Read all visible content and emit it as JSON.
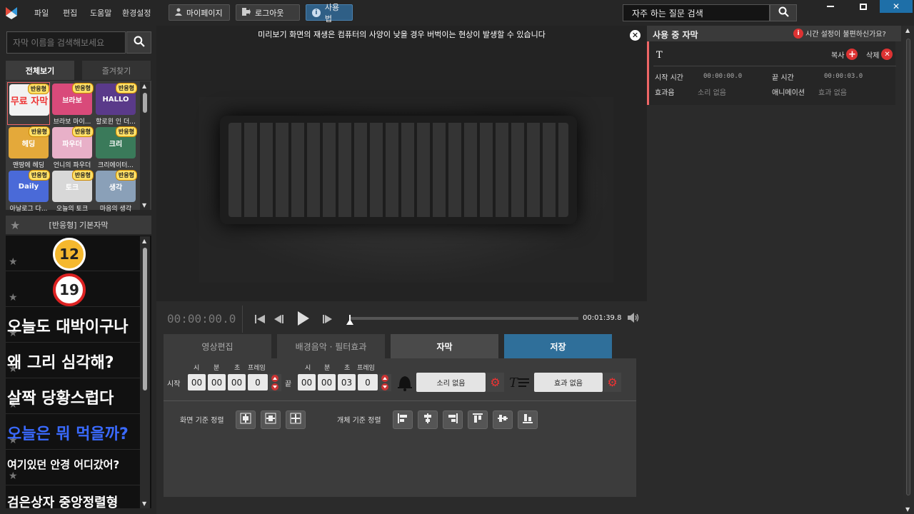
{
  "menu": [
    "파일",
    "편집",
    "도움말",
    "환경설정"
  ],
  "toolbar": {
    "mypage": "마이페이지",
    "logout": "로그아웃",
    "usage": "사용법"
  },
  "faq_search": {
    "text": "자주 하는 질문 검색"
  },
  "left": {
    "search_placeholder": "자막 이름을 검색해보세요",
    "tab_all": "전체보기",
    "tab_fav": "즐겨찾기",
    "badge": "반응형",
    "thumbs": [
      {
        "label": "",
        "art": "무료 자막",
        "color": "#f2f2f2"
      },
      {
        "label": "브라보 마이...",
        "art": "브라보",
        "color": "#d94a7a"
      },
      {
        "label": "할로윈 인 더...",
        "art": "HALLO",
        "color": "#5a3a8a"
      },
      {
        "label": "맨땅에 헤딩",
        "art": "헤딩",
        "color": "#e4a93a"
      },
      {
        "label": "언니의 파우더",
        "art": "파우더",
        "color": "#e8b0c8"
      },
      {
        "label": "크리에이터...",
        "art": "크리",
        "color": "#3a7a5a"
      },
      {
        "label": "아날로그 다...",
        "art": "Daily",
        "color": "#4a6ad8"
      },
      {
        "label": "오늘의 토크",
        "art": "토크",
        "color": "#d8d8d8"
      },
      {
        "label": "마음의 생각",
        "art": "생각",
        "color": "#8aa0b8"
      }
    ],
    "list_header": "[반응형] 기본자막",
    "list": [
      {
        "text": "12",
        "kind": "age12"
      },
      {
        "text": "19",
        "kind": "age19"
      },
      {
        "text": "오늘도 대박이구나",
        "kind": "text"
      },
      {
        "text": "왜 그리 심각해?",
        "kind": "text"
      },
      {
        "text": "살짝 당황스럽다",
        "kind": "text"
      },
      {
        "text": "오늘은 뭐 먹을까?",
        "kind": "text"
      },
      {
        "text": "여기있던 안경 어디갔어?",
        "kind": "text"
      },
      {
        "text": "검은상자 중앙정렬형",
        "kind": "text"
      }
    ]
  },
  "preview": {
    "notice": "미리보기 화면의 재생은 컴퓨터의 사양이 낮을 경우 버벅이는 현상이 발생할 수 있습니다"
  },
  "player": {
    "timecode": "00:00:00.0",
    "end_time": "00:01:39.8",
    "progress": 0
  },
  "edit_tabs": [
    "영상편집",
    "배경음악 · 필터효과",
    "자막",
    "저장"
  ],
  "timing": {
    "start_label": "시작",
    "end_label": "끝",
    "units": [
      "시",
      "분",
      "초",
      "프레임"
    ],
    "start": [
      "00",
      "00",
      "00",
      "0"
    ],
    "end": [
      "00",
      "00",
      "03",
      "0"
    ],
    "sound": "소리 없음",
    "effect": "효과 없음"
  },
  "align": {
    "screen_label": "화면 기준 정렬",
    "object_label": "개체 기준 정렬"
  },
  "right": {
    "title": "사용 중 자막",
    "help": "시간 설정이 불편하신가요?",
    "card": {
      "icon": "T",
      "copy": "복사",
      "delete": "삭제",
      "start_label": "시작 시간",
      "start_value": "00:00:00.0",
      "end_label": "끝 시간",
      "end_value": "00:00:03.0",
      "sound_label": "효과음",
      "sound_value": "소리 없음",
      "anim_label": "애니메이션",
      "anim_value": "효과 없음"
    }
  }
}
